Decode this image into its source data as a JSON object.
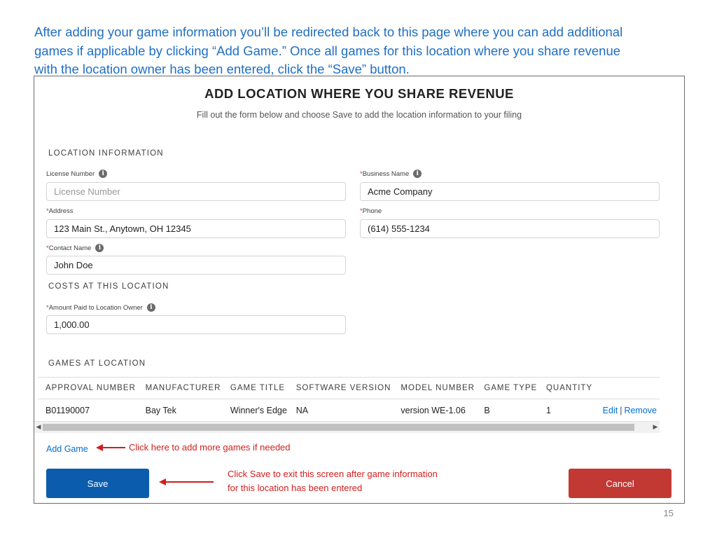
{
  "slide": {
    "intro_line1": "After adding your game information you’ll be redirected back to this page where you can add additional",
    "intro_line2": "games if applicable by clicking “Add Game.”  Once all games for this location where you share revenue",
    "intro_line3": "with the location owner has been entered, click the “Save” button.",
    "page_number": "15"
  },
  "form": {
    "title": "ADD LOCATION WHERE YOU SHARE REVENUE",
    "subtitle": "Fill out the form below and choose Save to add the location information to your filing"
  },
  "location_section": {
    "heading": "LOCATION INFORMATION",
    "license_number": {
      "label": "License Number",
      "required": false,
      "value": "",
      "placeholder": "License Number"
    },
    "business_name": {
      "label": "Business Name",
      "required": true,
      "value": "Acme Company"
    },
    "address": {
      "label": "Address",
      "required": true,
      "value": "123 Main St., Anytown, OH 12345"
    },
    "phone": {
      "label": "Phone",
      "required": true,
      "value": "(614) 555-1234"
    },
    "contact_name": {
      "label": "Contact Name",
      "required": true,
      "value": "John Doe"
    }
  },
  "costs_section": {
    "heading": "COSTS AT THIS LOCATION",
    "amount_paid": {
      "label": "Amount Paid to Location Owner",
      "required": true,
      "value": "1,000.00"
    }
  },
  "games_section": {
    "heading": "GAMES AT LOCATION",
    "columns": [
      "APPROVAL NUMBER",
      "MANUFACTURER",
      "GAME TITLE",
      "SOFTWARE VERSION",
      "MODEL NUMBER",
      "GAME TYPE",
      "QUANTITY"
    ],
    "rows": [
      {
        "approval_number": "B01190007",
        "manufacturer": "Bay Tek",
        "game_title": "Winner's Edge",
        "software_version": "NA",
        "model_number": "version WE-1.06",
        "game_type": "B",
        "quantity": "1",
        "edit_label": "Edit",
        "separator": "|",
        "remove_label": "Remove"
      }
    ],
    "add_game_label": "Add Game"
  },
  "annotations": {
    "add_game_note": "Click here to add more games if needed",
    "save_note_line1": "Click Save to exit this screen after game information",
    "save_note_line2": "for this location has been entered"
  },
  "buttons": {
    "save_label": "Save",
    "cancel_label": "Cancel"
  },
  "icons": {
    "info": "info-icon",
    "scroll_left": "chevron-left-icon",
    "scroll_right": "chevron-right-icon",
    "arrow": "arrow-left-icon"
  },
  "colors": {
    "intro_text": "#1f6fc2",
    "save_button": "#0b5cad",
    "cancel_button": "#c23934",
    "annotation": "#d01e1e",
    "link": "#0070d2"
  }
}
